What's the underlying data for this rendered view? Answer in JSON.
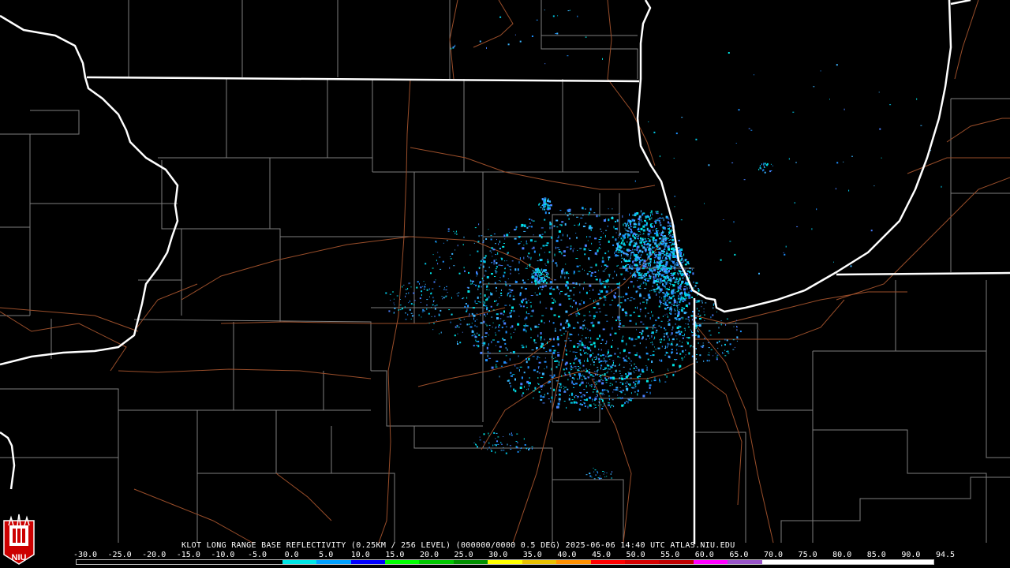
{
  "product": {
    "caption": "KLOT LONG RANGE BASE REFLECTIVITY (0.25KM / 256 LEVEL) (000000/0000 0.5 DEG) 2025-06-06 14:40 UTC  ATLAS.NIU.EDU"
  },
  "color_scale": {
    "labels": [
      "-30.0",
      "-25.0",
      "-20.0",
      "-15.0",
      "-10.0",
      "-5.0",
      "0.0",
      "5.0",
      "10.0",
      "15.0",
      "20.0",
      "25.0",
      "30.0",
      "35.0",
      "40.0",
      "45.0",
      "50.0",
      "55.0",
      "60.0",
      "65.0",
      "70.0",
      "75.0",
      "80.0",
      "85.0",
      "90.0",
      "94.5"
    ],
    "colors": [
      "#000000",
      "#000000",
      "#000000",
      "#000000",
      "#000000",
      "#000000",
      "#00e6e6",
      "#00a0ff",
      "#0000ff",
      "#00ff00",
      "#00c800",
      "#009000",
      "#ffff00",
      "#e7c000",
      "#ff9000",
      "#ff0000",
      "#d60000",
      "#c00000",
      "#ff00ff",
      "#9955c9",
      "#ffffff",
      "#ffffff",
      "#ffffff",
      "#ffffff",
      "#ffffff"
    ]
  },
  "logo": {
    "text": "NIU",
    "icon": "niu-shield-logo"
  },
  "map": {
    "state_boundary_color": "#ffffff",
    "county_line_color": "#8a8a8a",
    "highway_color": "#a0522d",
    "echo_colors": [
      "#00c8e6",
      "#1e90ff",
      "#3cb4ff",
      "#00e6e6",
      "#4a7fff"
    ]
  }
}
